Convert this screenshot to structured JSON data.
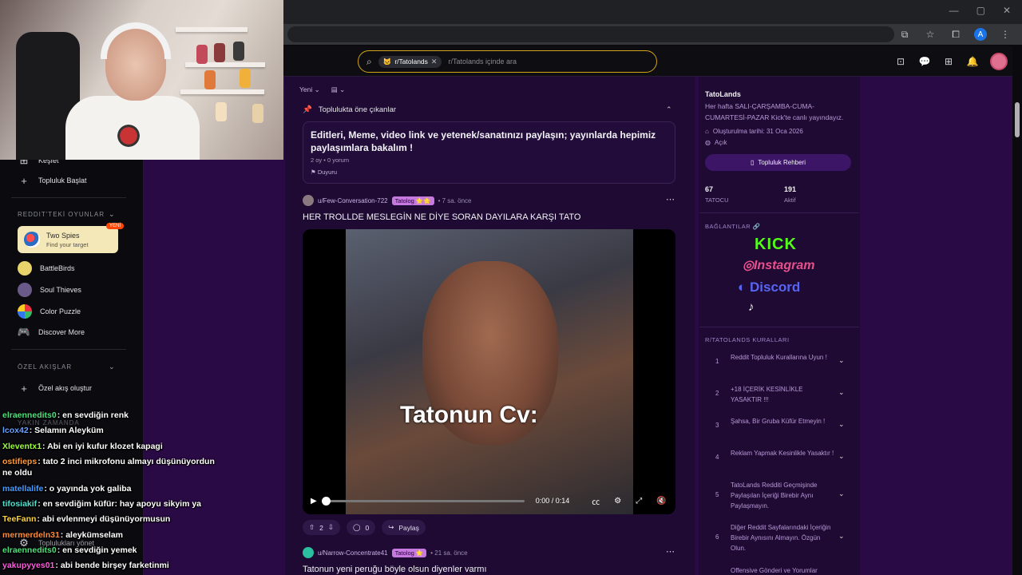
{
  "browser": {
    "window_controls": [
      "—",
      "▢",
      "✕"
    ],
    "profile_initial": "A"
  },
  "search": {
    "chip_label": "r/Tatolands",
    "placeholder": "r/Tatolands içinde ara"
  },
  "sidebar": {
    "top_items": [
      {
        "label": "Keşfet",
        "icon": "grid-icon"
      },
      {
        "label": "Topluluk Başlat",
        "icon": "plus-icon"
      }
    ],
    "games_header": "REDDIT'TEKİ OYUNLAR",
    "featured_game": {
      "title": "Two Spies",
      "subtitle": "Find your target",
      "badge": "YENİ"
    },
    "games": [
      "BattleBirds",
      "Soul Thieves",
      "Color Puzzle",
      "Discover More"
    ],
    "custom_feeds_header": "ÖZEL AKIŞLAR",
    "create_feed": "Özel akış oluştur",
    "recent_header": "YAKIN ZAMANDA",
    "manage_communities": "Toplulukları yönet"
  },
  "feed": {
    "sort_label": "Yeni",
    "highlights_label": "Toplulukta öne çıkanlar",
    "highlight_card": {
      "title": "Editleri, Meme, video link ve yetenek/sanatınızı paylaşın; yayınlarda hepimiz paylaşımlara bakalım !",
      "meta": "2 oy • 0 yorum",
      "flair": "Duyuru"
    },
    "posts": [
      {
        "author": "u/Few-Conversation-722",
        "flair": "Tatolog 🌟🌟",
        "time": "7 sa. önce",
        "title": "HER TROLLDE MESLEGİN NE DİYE SORAN DAYILARA KARŞI TATO",
        "video_caption": "Tatonun Cv:",
        "video_time": "0:00 / 0:14",
        "votes": "2",
        "comments": "0",
        "share": "Paylaş"
      },
      {
        "author": "u/Narrow-Concentrate41",
        "flair": "Tatolog 🌟",
        "time": "21 sa. önce",
        "title": "Tatonun yeni peruğu böyle olsun diyenler varmı"
      }
    ]
  },
  "community": {
    "name": "TatoLands",
    "description": "Her hafta SALI-ÇARŞAMBA-CUMA-CUMARTESİ-PAZAR Kick'te canlı yayındayız.",
    "created": "Oluşturulma tarihi: 31 Oca 2026",
    "visibility": "Açık",
    "guide_button": "Topluluk Rehberi",
    "members": "67",
    "members_label": "TATOCU",
    "online": "191",
    "online_label": "Aktif",
    "links_header": "BAĞLANTILAR 🔗",
    "links": [
      "KICK",
      "Instagram",
      "Discord"
    ],
    "rules_header": "R/TATOLANDS KURALLARI",
    "rules": [
      {
        "n": "1",
        "text": "Reddit Topluluk Kurallarına Uyun !"
      },
      {
        "n": "2",
        "text": "+18 İÇERİK KESİNLİKLE YASAKTIR !!!"
      },
      {
        "n": "3",
        "text": "Şahsa, Bir Gruba Küfür Etmeyin !"
      },
      {
        "n": "4",
        "text": "Reklam Yapmak Kesinlikle Yasaktır !"
      },
      {
        "n": "5",
        "text": "TatoLands Redditi Geçmişinde Paylaşılan İçeriği Birebir Aynı Paylaşmayın."
      },
      {
        "n": "6",
        "text": "Diğer Reddit Sayfalarındaki İçeriğin Birebir Aynısını Almayın. Özgün Olun."
      },
      {
        "n": "7",
        "text": "Offensive Gönderi ve Yorumlar"
      }
    ]
  },
  "chat": [
    {
      "user": "elraennedits0",
      "text": "en sevdiğin renk",
      "color": "#4ee07a"
    },
    {
      "user": "lcox42",
      "text": "Selamın Aleyküm",
      "color": "#6aa0ff"
    },
    {
      "user": "Xleventx1",
      "text": "Abi en iyi kufur klozet kapagi",
      "color": "#9cff3a"
    },
    {
      "user": "ostifieps",
      "text": "tato 2 inci mikrofonu almayı düşünüyordun ne oldu",
      "color": "#ff9a3a"
    },
    {
      "user": "matellalife",
      "text": "o yayında yok galiba",
      "color": "#4a9aff"
    },
    {
      "user": "tifosiakif",
      "text": "en sevdiğim küfür: hay apoyu sikyim ya",
      "color": "#4ee0d0"
    },
    {
      "user": "TeeFann",
      "text": "abi evlenmeyi düşünüyormusun",
      "color": "#ffd23a"
    },
    {
      "user": "mermerdeln31",
      "text": "aleykümselam",
      "color": "#ff8a3a"
    },
    {
      "user": "elraennedits0",
      "text": "en sevdiğin yemek",
      "color": "#4ee07a"
    },
    {
      "user": "yakupyyes01",
      "text": "abi bende birşey farketinmi",
      "color": "#ff5ae0"
    }
  ],
  "colors": {
    "page_bg": "#2a0a45",
    "feed_bg": "#1e0a33",
    "flair": "#c67ae0",
    "search_border": "#d1a41a"
  }
}
